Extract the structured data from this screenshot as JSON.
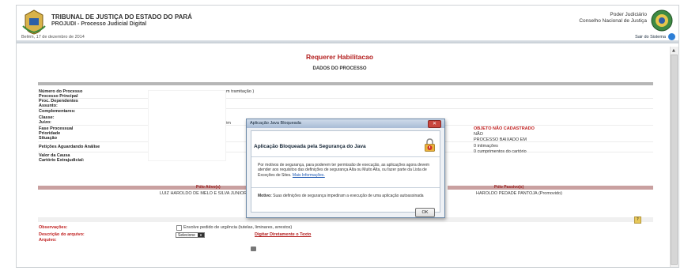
{
  "header": {
    "court_name": "TRIBUNAL DE JUSTIÇA DO ESTADO DO PARÁ",
    "system_name": "PROJUDI - Processo Judicial Digital",
    "date_line": "Belém, 17 de dezembro de 2014",
    "power_line1": "Poder Judiciário",
    "power_line2": "Conselho Nacional de Justiça",
    "exit_label": "Sair do Sistema"
  },
  "page": {
    "title": "Requerer Habilitacao",
    "subtitle": "DADOS DO PROCESSO"
  },
  "fields": {
    "labels": [
      "Número do Processo",
      "Processo Principal",
      "Proc. Dependentes",
      "Assunto:",
      "Complementares:",
      "Classe:",
      "Juízo:",
      "Fase Processual",
      "Prioridade",
      "Situação",
      "Petições Aguardando Análise",
      "Valor da Causa",
      "Cartório Extrajudicial:"
    ],
    "numero_suffix": "em tramitação )",
    "juizo_suffix": "lém",
    "right_values": [
      "OBJETO NÃO CADASTRADO",
      "NÃO",
      "PROCESSO BAIXADO EM",
      "0 intimações",
      "0 cumprimentos do cartório"
    ]
  },
  "polos": {
    "ativo_label": "Pólo Ativo(s)",
    "ativo_value": "LUIZ HAROLDO DE MELO E SILVA JUNIOR (Pro",
    "passivo_label": "Pólo Passivo(s)",
    "passivo_value": "HAROLDO PEDADE PANTOJA (Promovido)"
  },
  "form": {
    "observacoes_label": "Observações:",
    "urgencia_label": "Envolve pedido de urgência (tutelas, liminares, arrestos)",
    "descricao_label": "Descrição do arquivo:",
    "select_value": "Selecione",
    "digitar_link": "Digitar Diretamente o Texto",
    "arquivo_label": "Arquivo:",
    "help_icon": "?"
  },
  "dialog": {
    "window_title": "Aplicação Java Bloqueada",
    "heading": "Aplicação Bloqueada pela Segurança do Java",
    "body": "Por motivos de segurança, para poderem ter permissão de execução, as aplicações agora devem atender aos requisitos das definições de segurança Alta ou Muito Alta, ou fazer parte da Lista de Exceções de Sites.",
    "more_link": "Mais Informações.",
    "reason_label": "Motivo:",
    "reason_text": "Suas definições de segurança impediram a execução de uma aplicação autoassinada",
    "ok_label": "OK",
    "close_glyph": "✕"
  },
  "icons": {
    "logo": "court-crest-icon",
    "seal": "cnj-seal-icon",
    "exit": "exit-icon",
    "lock": "warning-lock-icon",
    "printer": "printer-icon"
  }
}
